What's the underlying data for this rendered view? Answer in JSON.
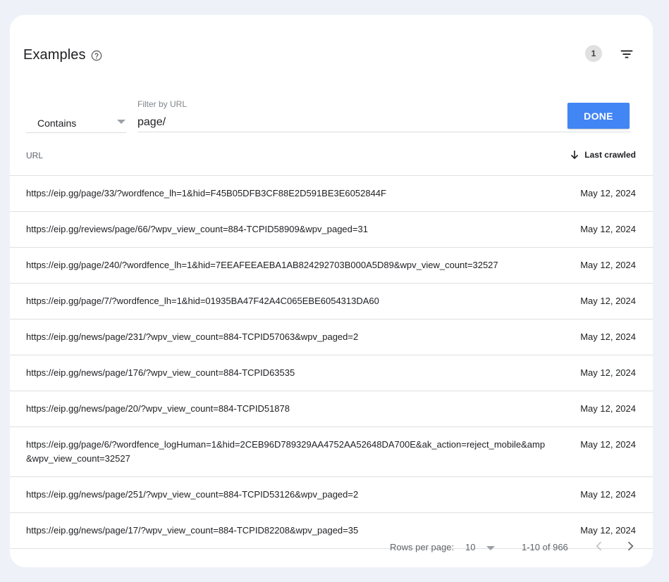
{
  "card": {
    "title": "Examples",
    "icon_help": "help-circle-icon",
    "filter_count": "1",
    "icon_filter": "filter-list-icon"
  },
  "filter": {
    "operator": "Contains",
    "url_label": "Filter by URL",
    "url_value": "page/",
    "done_label": "DONE",
    "accent_color": "#4285f4"
  },
  "table": {
    "col_url": "URL",
    "col_crawled": "Last crawled",
    "sort_icon": "arrow-down-icon",
    "rows": [
      {
        "url": "https://eip.gg/page/33/?wordfence_lh=1&hid=F45B05DFB3CF88E2D591BE3E6052844F",
        "date": "May 12, 2024"
      },
      {
        "url": "https://eip.gg/reviews/page/66/?wpv_view_count=884-TCPID58909&wpv_paged=31",
        "date": "May 12, 2024"
      },
      {
        "url": "https://eip.gg/page/240/?wordfence_lh=1&hid=7EEAFEEAEBA1AB824292703B000A5D89&wpv_view_count=32527",
        "date": "May 12, 2024"
      },
      {
        "url": "https://eip.gg/page/7/?wordfence_lh=1&hid=01935BA47F42A4C065EBE6054313DA60",
        "date": "May 12, 2024"
      },
      {
        "url": "https://eip.gg/news/page/231/?wpv_view_count=884-TCPID57063&wpv_paged=2",
        "date": "May 12, 2024"
      },
      {
        "url": "https://eip.gg/news/page/176/?wpv_view_count=884-TCPID63535",
        "date": "May 12, 2024"
      },
      {
        "url": "https://eip.gg/news/page/20/?wpv_view_count=884-TCPID51878",
        "date": "May 12, 2024"
      },
      {
        "url": "https://eip.gg/page/6/?wordfence_logHuman=1&hid=2CEB96D789329AA4752AA52648DA700E&ak_action=reject_mobile&amp&wpv_view_count=32527",
        "date": "May 12, 2024"
      },
      {
        "url": "https://eip.gg/news/page/251/?wpv_view_count=884-TCPID53126&wpv_paged=2",
        "date": "May 12, 2024"
      },
      {
        "url": "https://eip.gg/news/page/17/?wpv_view_count=884-TCPID82208&wpv_paged=35",
        "date": "May 12, 2024"
      }
    ]
  },
  "pagination": {
    "rows_per_page_label": "Rows per page:",
    "rows_per_page_value": "10",
    "range": "1-10 of 966",
    "prev_icon": "chevron-left-icon",
    "next_icon": "chevron-right-icon"
  }
}
